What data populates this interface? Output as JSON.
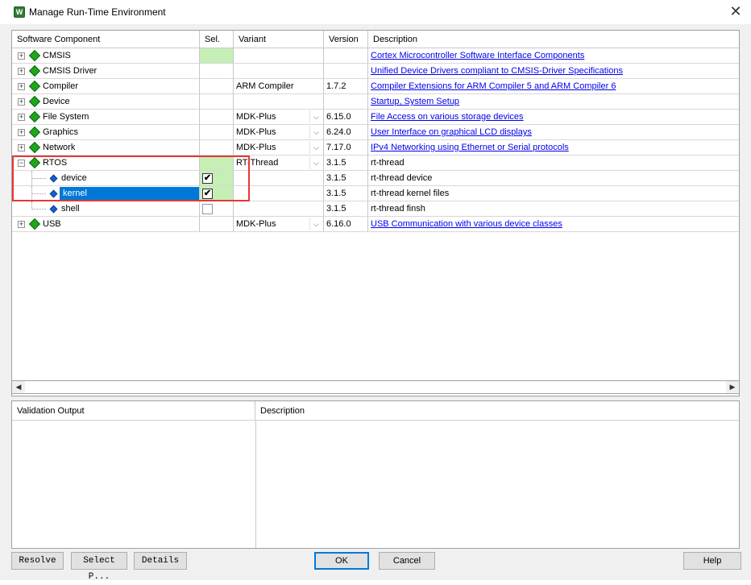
{
  "window": {
    "title": "Manage Run-Time Environment",
    "app_icon_glyph": "W",
    "close_glyph": "✕"
  },
  "grid": {
    "headers": [
      "Software Component",
      "Sel.",
      "Variant",
      "Version",
      "Description"
    ],
    "rows": [
      {
        "component": "CMSIS",
        "expander": "+",
        "sel_green": true,
        "variant": "",
        "version": "",
        "description": "Cortex Microcontroller Software Interface Components",
        "link": true
      },
      {
        "component": "CMSIS Driver",
        "expander": "+",
        "variant": "",
        "version": "",
        "description": "Unified Device Drivers compliant to CMSIS-Driver Specifications",
        "link": true
      },
      {
        "component": "Compiler",
        "expander": "+",
        "variant": "ARM Compiler",
        "version": "1.7.2",
        "description": "Compiler Extensions for ARM Compiler 5 and ARM Compiler 6",
        "link": true
      },
      {
        "component": "Device",
        "expander": "+",
        "variant": "",
        "version": "",
        "description": "Startup, System Setup",
        "link": true
      },
      {
        "component": "File System",
        "expander": "+",
        "variant": "MDK-Plus",
        "dropdown": true,
        "version": "6.15.0",
        "description": "File Access on various storage devices",
        "link": true
      },
      {
        "component": "Graphics",
        "expander": "+",
        "variant": "MDK-Plus",
        "dropdown": true,
        "version": "6.24.0",
        "description": "User Interface on graphical LCD displays",
        "link": true
      },
      {
        "component": "Network",
        "expander": "+",
        "variant": "MDK-Plus",
        "dropdown": true,
        "version": "7.17.0",
        "description": "IPv4 Networking using Ethernet or Serial protocols",
        "link": true
      },
      {
        "component": "RTOS",
        "expander": "−",
        "sel_green": true,
        "variant": "RT-Thread",
        "dropdown": true,
        "version": "3.1.5",
        "description": "rt-thread",
        "link": false
      },
      {
        "component": "device",
        "child": true,
        "checked": true,
        "sel_green": true,
        "variant": "",
        "version": "3.1.5",
        "description": "rt-thread device",
        "link": false
      },
      {
        "component": "kernel",
        "child": true,
        "selected": true,
        "checked": true,
        "sel_green": true,
        "variant": "",
        "version": "3.1.5",
        "description": "rt-thread kernel files",
        "link": false
      },
      {
        "component": "shell",
        "child": true,
        "last_child": true,
        "checked": false,
        "variant": "",
        "version": "3.1.5",
        "description": "rt-thread finsh",
        "link": false
      },
      {
        "component": "USB",
        "expander": "+",
        "variant": "MDK-Plus",
        "dropdown": true,
        "version": "6.16.0",
        "description": "USB Communication with various device classes",
        "link": true
      }
    ]
  },
  "scrollbar": {
    "left_arrow": "◀",
    "right_arrow": "▶"
  },
  "validation": {
    "headers": [
      "Validation Output",
      "Description"
    ]
  },
  "buttons": {
    "resolve": "Resolve",
    "select_packs": "Select P...",
    "details": "Details",
    "ok": "OK",
    "cancel": "Cancel",
    "help": "Help"
  },
  "colors": {
    "selection_blue": "#0078d7",
    "sel_green": "#c6efb6",
    "component_green": "#1fa51f",
    "highlight_red": "#e53935",
    "link": "#0000ee"
  }
}
